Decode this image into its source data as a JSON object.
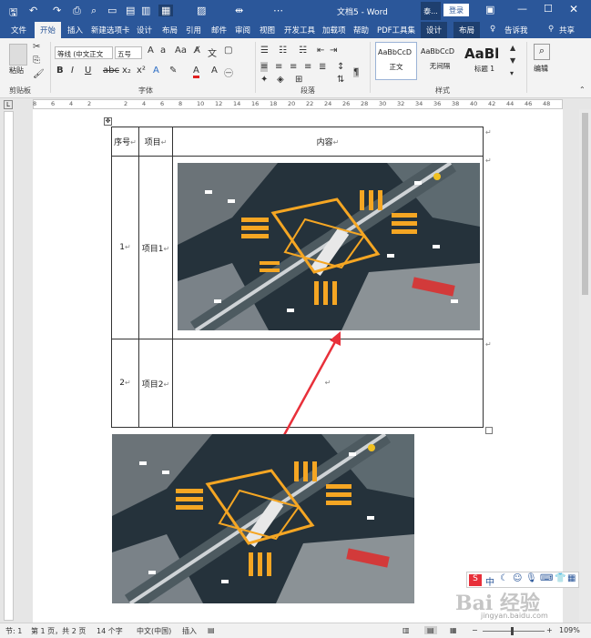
{
  "window": {
    "title": "文档5 - Word",
    "account_short": "泰...",
    "login_label": "登录"
  },
  "tabs": [
    "文件",
    "开始",
    "插入",
    "新建选项卡",
    "设计",
    "布局",
    "引用",
    "邮件",
    "审阅",
    "视图",
    "开发工具",
    "加载项",
    "帮助",
    "PDF工具集",
    "设计",
    "布局",
    "告诉我",
    "共享"
  ],
  "ribbon": {
    "paste_label": "粘贴",
    "font_name": "等线 (中文正文",
    "font_size": "五号",
    "styles": [
      {
        "preview": "AaBbCcD",
        "name": "正文"
      },
      {
        "preview": "AaBbCcD",
        "name": "无间隔"
      },
      {
        "preview": "AaBl",
        "name": "标题 1"
      }
    ],
    "edit_label": "编辑",
    "groups": [
      "剪贴板",
      "字体",
      "段落",
      "样式"
    ]
  },
  "ruler": {
    "ticks": [
      "8",
      "6",
      "4",
      "2",
      "",
      "2",
      "4",
      "6",
      "8",
      "10",
      "12",
      "14",
      "16",
      "18",
      "20",
      "22",
      "24",
      "26",
      "28",
      "30",
      "32",
      "34",
      "36",
      "38",
      "40",
      "42",
      "44",
      "46",
      "48"
    ]
  },
  "table": {
    "headers": [
      "序号",
      "项目",
      "内容"
    ],
    "rows": [
      {
        "no": "1",
        "item": "项目1"
      },
      {
        "no": "2",
        "item": "项目2"
      }
    ]
  },
  "status": {
    "page": "节: 1",
    "pages": "第 1 页，共 2 页",
    "words": "14 个字",
    "lang": "中文(中国)",
    "mode": "插入",
    "zoom": "109%"
  },
  "watermark": {
    "brand": "Bai 经验",
    "url": "jingyan.baidu.com",
    "ime": "中"
  },
  "colors": {
    "accent": "#2b579a",
    "arrow": "#e8303a",
    "crosswalk": "#f5a623"
  }
}
